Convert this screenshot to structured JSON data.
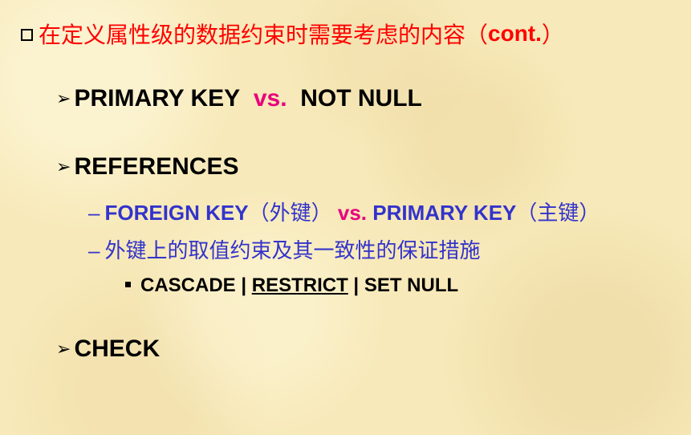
{
  "title": {
    "text": "在定义属性级的数据约束时需要考虑的内容（",
    "cont": "cont.",
    "close": "）"
  },
  "item1": {
    "arrow": "➢",
    "left": "PRIMARY KEY",
    "vs": "vs.",
    "right": "NOT NULL"
  },
  "item2": {
    "arrow": "➢",
    "label": "REFERENCES",
    "sub1": {
      "dash": "–",
      "fk": "FOREIGN KEY",
      "fk_cn": "（外键）",
      "vs": "vs.",
      "pk": "PRIMARY KEY",
      "pk_cn": "（主键）"
    },
    "sub2": {
      "dash": "–",
      "text": "外键上的取值约束及其一致性的保证措施"
    },
    "sub3": {
      "opt1": "CASCADE",
      "sep1": " | ",
      "opt2": "RESTRICT",
      "sep2": " | ",
      "opt3": "SET NULL"
    }
  },
  "item3": {
    "arrow": "➢",
    "label": "CHECK"
  }
}
